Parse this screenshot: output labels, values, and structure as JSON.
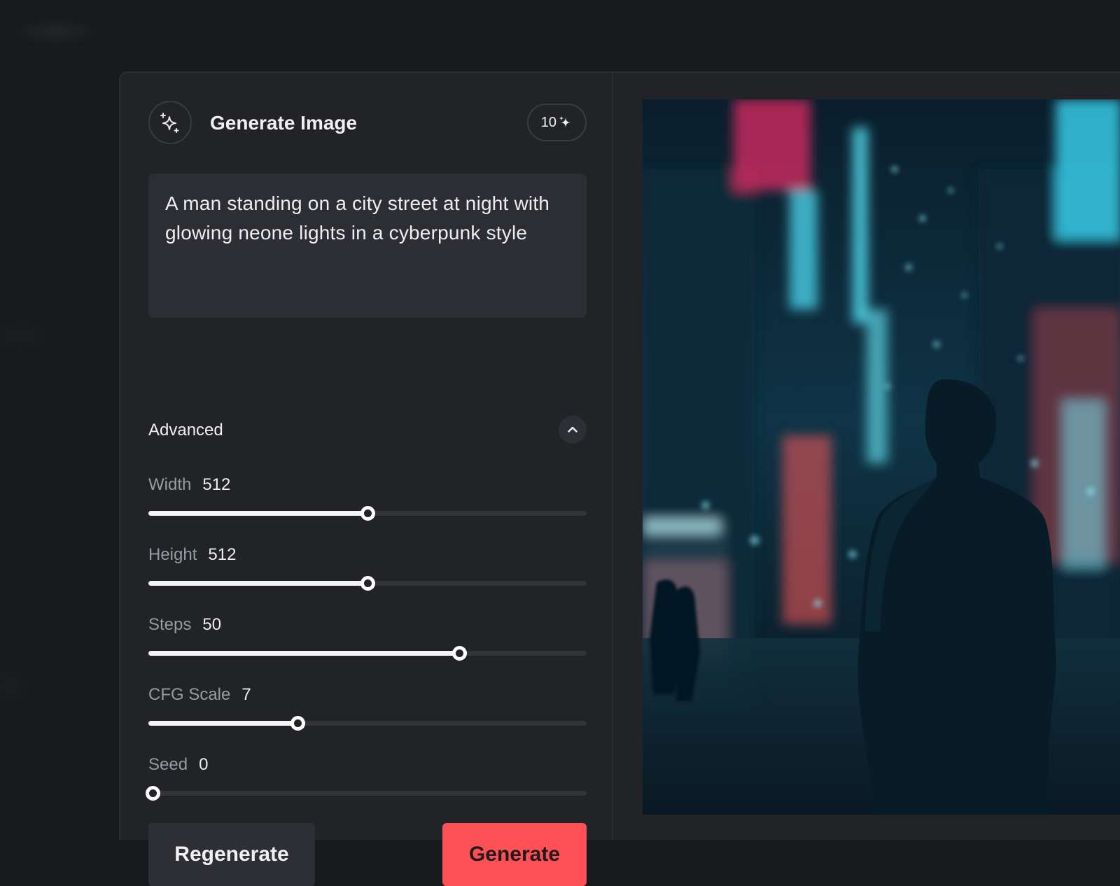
{
  "header": {
    "title": "Generate Image",
    "credits": "10"
  },
  "prompt": {
    "value": "A man standing on a city street at night with glowing neone lights in a cyberpunk style"
  },
  "advanced": {
    "label": "Advanced",
    "expanded": true
  },
  "sliders": [
    {
      "name": "Width",
      "value": "512",
      "level": 0.5
    },
    {
      "name": "Height",
      "value": "512",
      "level": 0.5
    },
    {
      "name": "Steps",
      "value": "50",
      "level": 0.71
    },
    {
      "name": "CFG Scale",
      "value": "7",
      "level": 0.34
    },
    {
      "name": "Seed",
      "value": "0",
      "level": 0.0
    }
  ],
  "buttons": {
    "regenerate": "Regenerate",
    "generate": "Generate"
  },
  "colors": {
    "accent": "#fe5155",
    "panel": "#222327",
    "input": "#2d2e33"
  },
  "icons": {
    "logo": "sparkles-icon",
    "credits": "sparkles-icon",
    "collapse": "chevron-up-icon"
  }
}
